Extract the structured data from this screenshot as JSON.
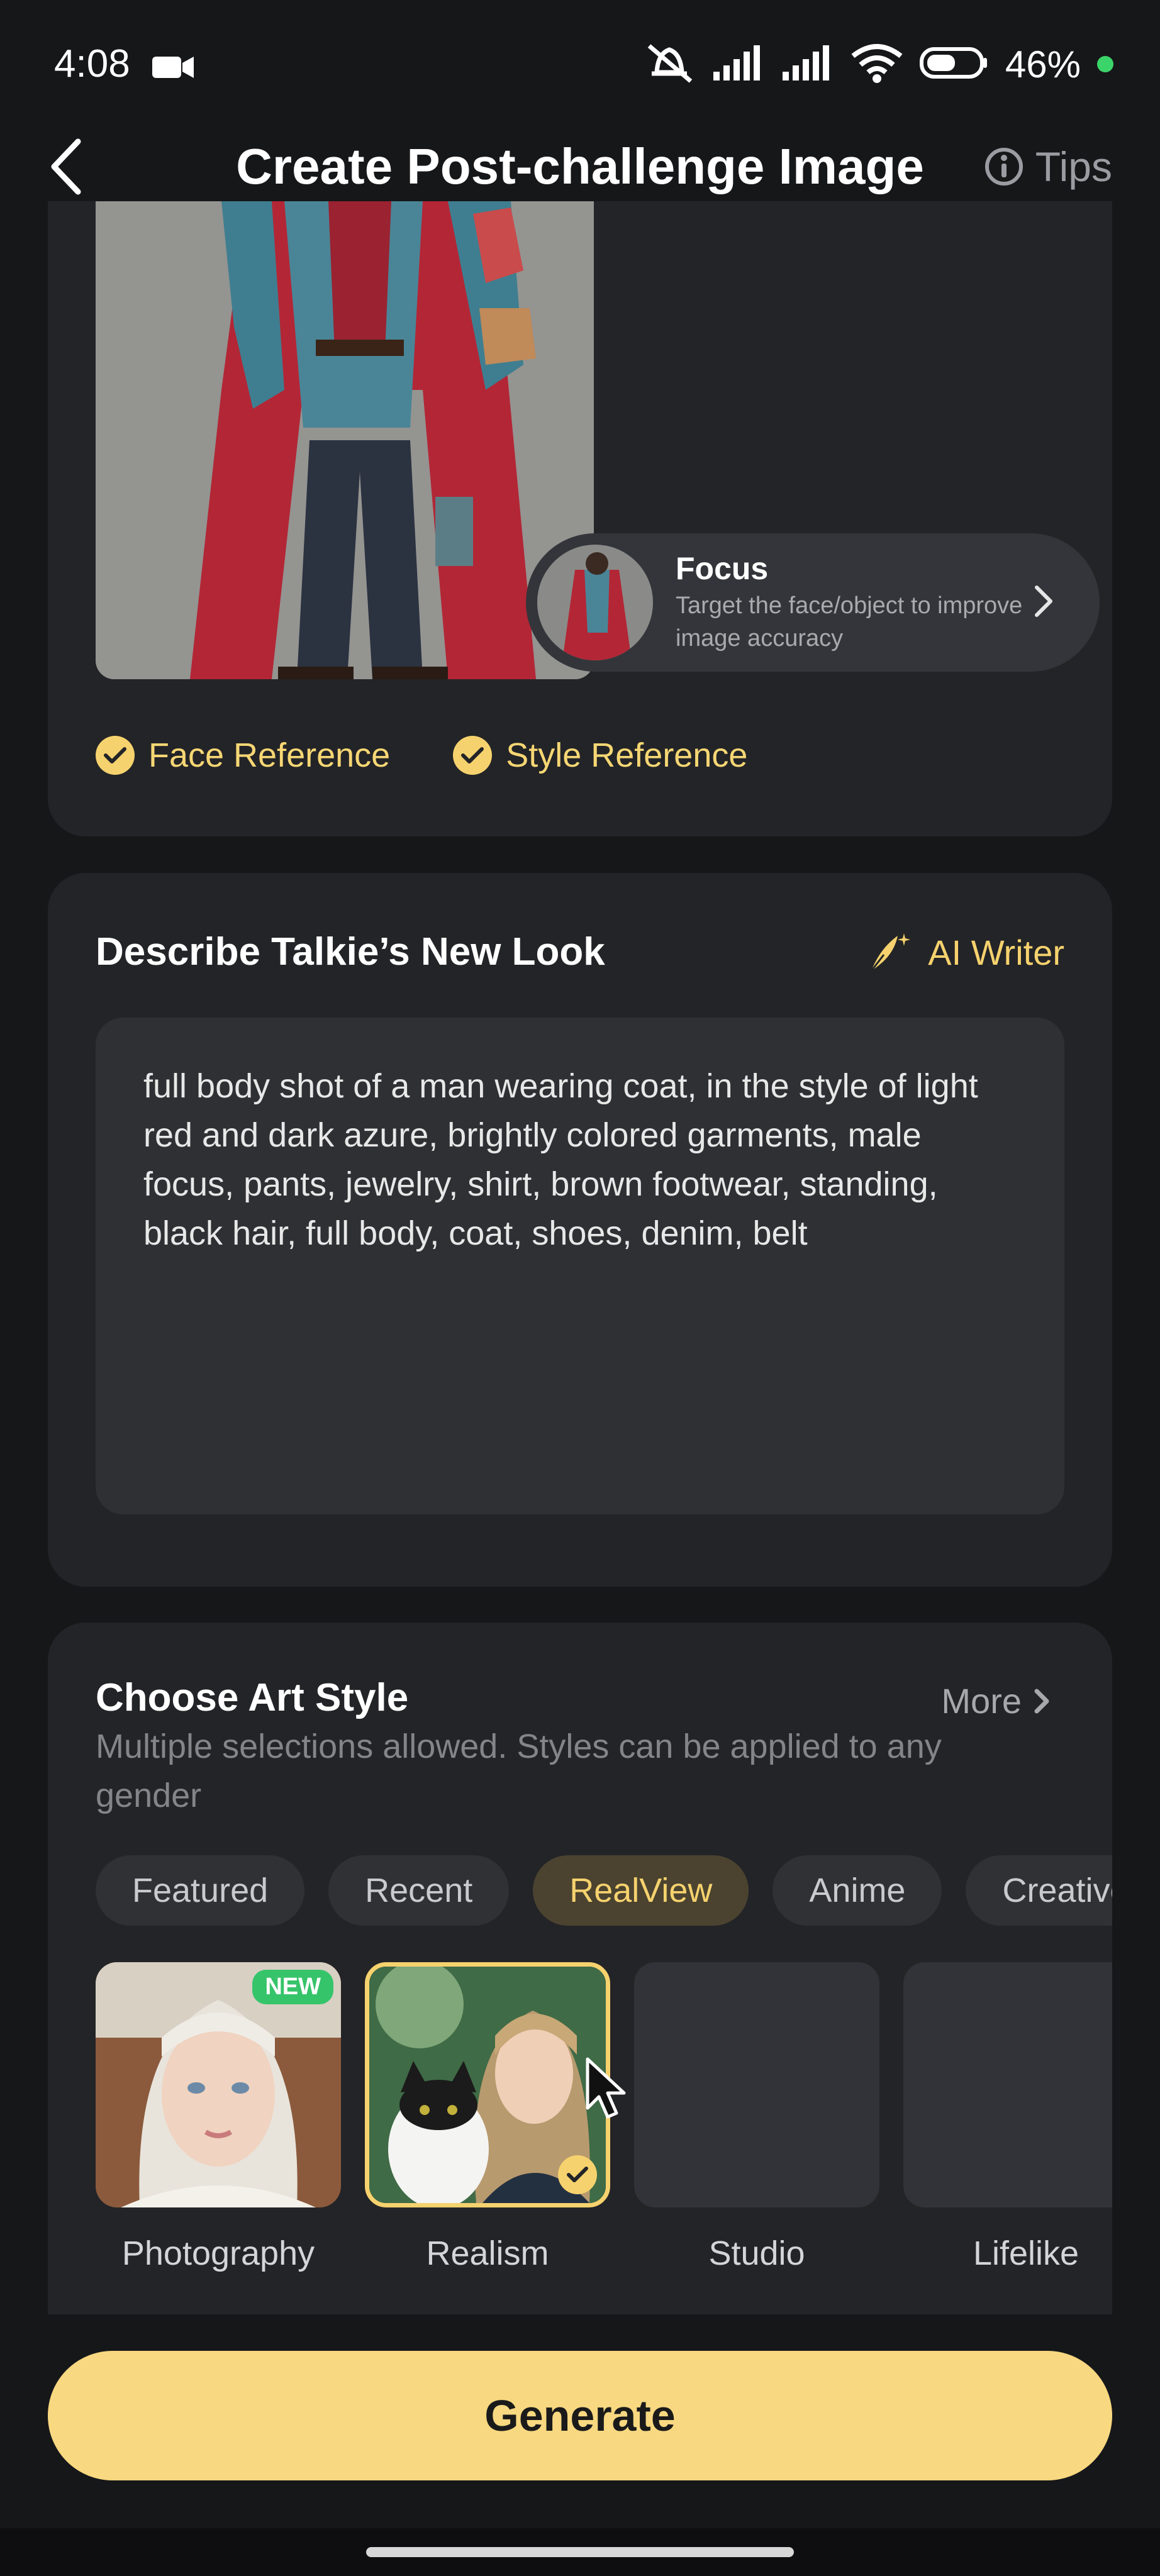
{
  "status_bar": {
    "time": "4:08",
    "battery": "46%",
    "icons": [
      "camera-icon",
      "mute-icon",
      "signal-icon",
      "signal-icon",
      "wifi-icon",
      "battery-icon"
    ]
  },
  "header": {
    "title": "Create Post-challenge Image",
    "tips_label": "Tips"
  },
  "reference": {
    "focus_title": "Focus",
    "focus_subtitle": "Target the face/object to improve image accuracy",
    "checks": [
      "Face Reference",
      "Style Reference"
    ]
  },
  "describe": {
    "title": "Describe Talkie’s New Look",
    "ai_writer_label": "AI Writer",
    "prompt_text": "full body shot of a man wearing coat, in the style of light red and dark azure, brightly colored garments, male focus, pants, jewelry, shirt, brown footwear, standing, black hair, full body, coat, shoes, denim, belt"
  },
  "art_style": {
    "title": "Choose Art Style",
    "more_label": "More",
    "subtitle": "Multiple selections allowed. Styles can be applied to any gender",
    "tabs": [
      "Featured",
      "Recent",
      "RealView",
      "Anime",
      "Creative"
    ],
    "active_tab": "RealView",
    "styles": [
      {
        "label": "Photography",
        "badge": "NEW"
      },
      {
        "label": "Realism",
        "selected": true
      },
      {
        "label": "Studio"
      },
      {
        "label": "Lifelike"
      }
    ]
  },
  "generate_label": "Generate",
  "colors": {
    "accent": "#f6d26e",
    "background": "#161719",
    "card": "#232427",
    "new_badge": "#36c46a"
  }
}
